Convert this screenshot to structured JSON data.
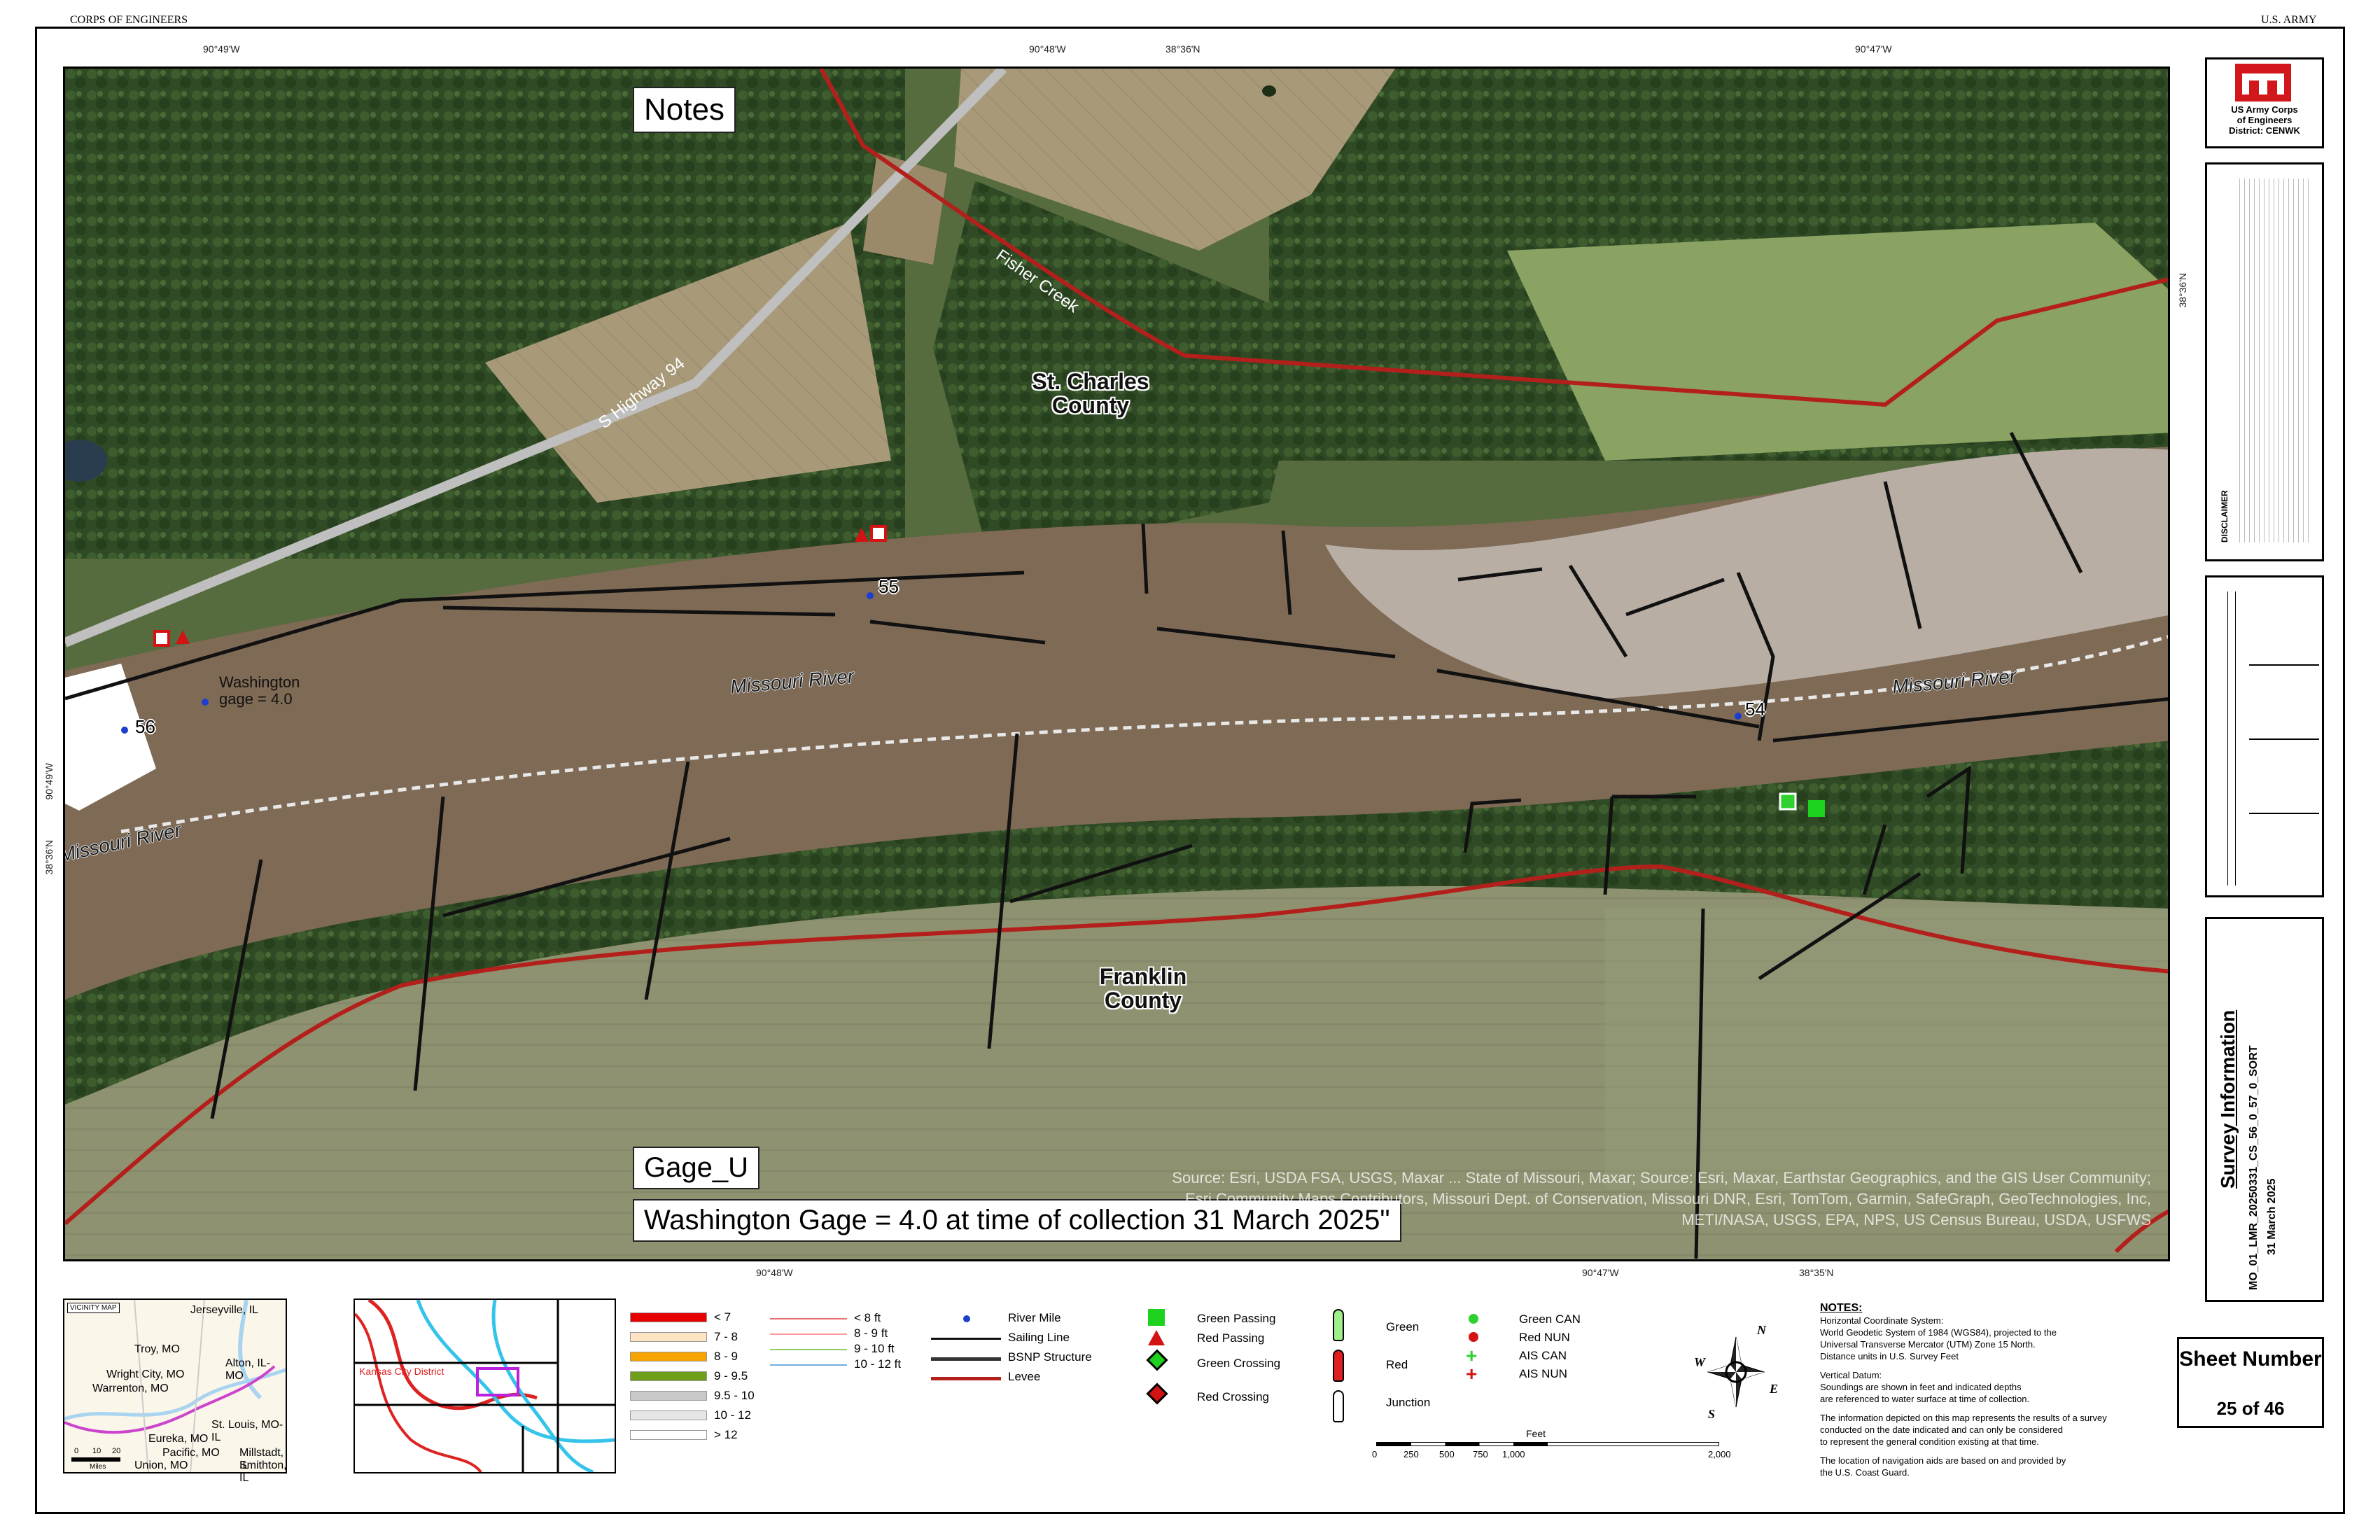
{
  "header": {
    "left": "CORPS OF ENGINEERS",
    "right": "U.S. ARMY"
  },
  "coords": {
    "top": [
      "90°49'W",
      "90°48'W",
      "38°36'N",
      "90°47'W"
    ],
    "bottom": [
      "90°48'W",
      "90°47'W",
      "38°35'N"
    ],
    "left": [
      "90°49'W",
      "38°36'N"
    ],
    "right": [
      "38°36'N"
    ]
  },
  "map": {
    "notes_label": "Notes",
    "gage_label": "Gage_U",
    "gage_caption": "Washington Gage = 4.0 at time of collection 31 March 2025\"",
    "places": {
      "st_charles": "St. Charles County",
      "franklin": "Franklin County"
    },
    "features": {
      "highway": "S Highway 94",
      "creek": "Fisher Creek",
      "river_left": "Missouri River",
      "river_mid": "Missouri River",
      "river_right": "Missouri River",
      "washington_gage": "Washington gage = 4.0"
    },
    "river_miles": [
      "56",
      "55",
      "54"
    ],
    "attribution": "Source: Esri, USDA FSA, USGS, Maxar ... State of Missouri, Maxar; Source: Esri, Maxar, Earthstar Geographics, and the GIS User Community; Esri Community Maps Contributors, Missouri Dept. of Conservation, Missouri DNR, Esri, TomTom, Garmin, SafeGraph, GeoTechnologies, Inc, METI/NASA, USGS, EPA, NPS, US Census Bureau, USDA, USFWS"
  },
  "colors": {
    "levee": "#b3201c",
    "sailing_line": "#111111",
    "river_mile": "#1a3fcf",
    "green_nav": "#22cc22",
    "red_nav": "#dd1111"
  },
  "right_panel": {
    "logo_text": [
      "US Army Corps",
      "of Engineers",
      "District: CENWK"
    ],
    "disclaimer_title": "DISCLAIMER",
    "survey_info": "Survey Information",
    "survey_file": "MO_01_LMR_20250331_CS_56_0_57_0_SORT",
    "survey_date": "31 March 2025",
    "sheet_label": "Sheet Number",
    "sheet_of": "25 of 46"
  },
  "vicinity_map": {
    "title": "VICINITY MAP",
    "cities": [
      "Jerseyville, IL",
      "Troy, MO",
      "Alton, IL-MO",
      "Wright City, MO",
      "Warrenton, MO",
      "St. Louis, MO-IL",
      "Eureka, MO",
      "Pacific, MO",
      "Millstadt, IL",
      "Union, MO",
      "Smithton, IL"
    ],
    "scale_labels": [
      "0",
      "10",
      "20"
    ],
    "scale_unit": "Miles"
  },
  "district_map": {
    "label": "Kansas City District"
  },
  "legend": {
    "depths": [
      {
        "label": "< 7",
        "color": "#e60000"
      },
      {
        "label": "7 - 8",
        "color": "#ffe4c4"
      },
      {
        "label": "8 - 9",
        "color": "#f5a400"
      },
      {
        "label": "9 - 9.5",
        "color": "#6f9e1a"
      },
      {
        "label": "9.5 - 10",
        "color": "#c8c8c8"
      },
      {
        "label": "10 - 12",
        "color": "#e6e6e6"
      },
      {
        "label": "> 12",
        "color": "#ffffff"
      }
    ],
    "contours": [
      {
        "label": "< 8 ft",
        "color": "#e87070"
      },
      {
        "label": "8 - 9 ft",
        "color": "#ff9999"
      },
      {
        "label": "9 - 10 ft",
        "color": "#8fcf70"
      },
      {
        "label": "10 - 12 ft",
        "color": "#70aedf"
      }
    ],
    "lines": [
      {
        "label": "River Mile"
      },
      {
        "label": "Sailing Line"
      },
      {
        "label": "BSNP Structure"
      },
      {
        "label": "Levee"
      }
    ],
    "navaids": [
      "Green Passing",
      "Red Passing",
      "Green Crossing",
      "Red Crossing"
    ],
    "lights": [
      "Green",
      "Red",
      "Junction"
    ],
    "buoys": [
      "Green CAN",
      "Red NUN",
      "AIS CAN",
      "AIS NUN"
    ]
  },
  "scale_bar": {
    "unit": "Feet",
    "ticks": [
      "0",
      "250",
      "500",
      "750",
      "1,000",
      "2,000"
    ]
  },
  "notes": {
    "title": "NOTES:",
    "lines": [
      "Horizontal Coordinate System:",
      "World Geodetic System of 1984 (WGS84), projected to the",
      "Universal Transverse Mercator (UTM) Zone 15 North.",
      "Distance units in U.S. Survey Feet",
      "",
      "Vertical Datum:",
      "Soundings are shown in feet and indicated depths",
      "are referenced to water surface at time of collection.",
      "",
      "The information depicted on this map represents the results of a survey",
      "conducted on the date indicated and can only be considered",
      "to represent the general condition existing at that time.",
      "",
      "The location of navigation aids are based on and provided by",
      "the U.S. Coast Guard."
    ]
  },
  "compass": {
    "n": "N",
    "s": "S",
    "e": "E",
    "w": "W"
  }
}
